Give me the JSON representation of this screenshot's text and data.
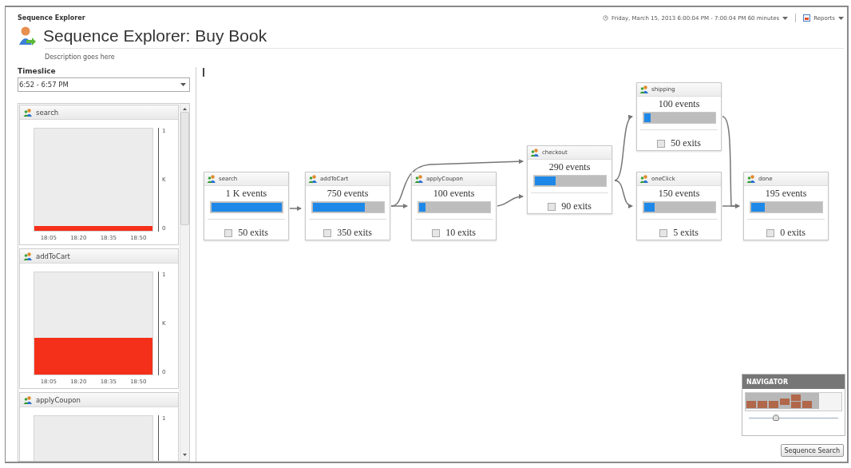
{
  "header": {
    "app_name": "Sequence Explorer",
    "title": "Sequence Explorer: Buy Book",
    "description": "Description goes here",
    "time_range": "Friday, March 15, 2013 6:00:04 PM - 7:00:04 PM 60 minutes",
    "reports": "Reports"
  },
  "timeslice": {
    "label": "Timeslice",
    "value": "6:52 - 6:57 PM"
  },
  "event_charts": [
    {
      "name": "search",
      "y_labels": [
        "1",
        "K",
        "0"
      ],
      "x_labels": [
        "18:05",
        "18:20",
        "18:35",
        "18:50"
      ]
    },
    {
      "name": "addToCart",
      "y_labels": [
        "1",
        "K",
        "0"
      ],
      "x_labels": [
        "18:05",
        "18:20",
        "18:35",
        "18:50"
      ]
    },
    {
      "name": "applyCoupon",
      "y_labels": [
        "1"
      ]
    }
  ],
  "nodes": [
    {
      "name": "search",
      "events": "1 K events",
      "level": 1.0,
      "exits": "50 exits",
      "checked": false
    },
    {
      "name": "addToCart",
      "events": "750 events",
      "level": 0.74,
      "exits": "350 exits",
      "checked": false
    },
    {
      "name": "applyCoupon",
      "events": "100 events",
      "level": 0.1,
      "exits": "10 exits",
      "checked": false
    },
    {
      "name": "checkout",
      "events": "290 events",
      "level": 0.3,
      "exits": "90 exits",
      "checked": false
    },
    {
      "name": "shipping",
      "events": "100 events",
      "level": 0.1,
      "exits": "50 exits",
      "checked": false
    },
    {
      "name": "oneClick",
      "events": "150 events",
      "level": 0.15,
      "exits": "5 exits",
      "checked": false
    },
    {
      "name": "done",
      "events": "195 events",
      "level": 0.2,
      "exits": "0 exits",
      "checked": false
    }
  ],
  "navigator": {
    "title": "NAVIGATOR",
    "level": 0.3
  },
  "sequence_search": "Sequence Search"
}
